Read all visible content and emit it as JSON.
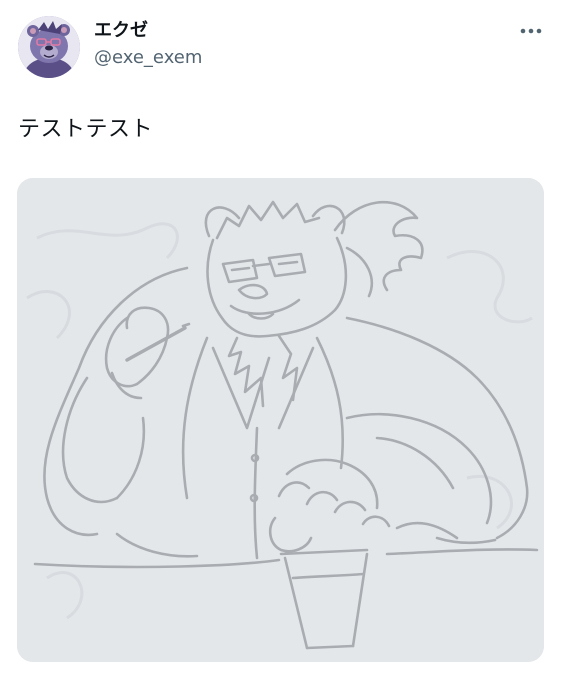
{
  "author": {
    "display_name": "エクゼ",
    "handle": "@exe_exem",
    "avatar_icon": "bear-avatar-icon"
  },
  "post": {
    "text": "テストテスト"
  },
  "menu": {
    "icon": "more-horizontal-icon"
  },
  "media": {
    "kind": "sketch-illustration",
    "icon": "bear-character-sketch"
  },
  "colors": {
    "secondary_text": "#536471",
    "media_background": "#e4e7ea",
    "sketch_line": "#a9adb1",
    "avatar_fill": "#8d86b8"
  }
}
